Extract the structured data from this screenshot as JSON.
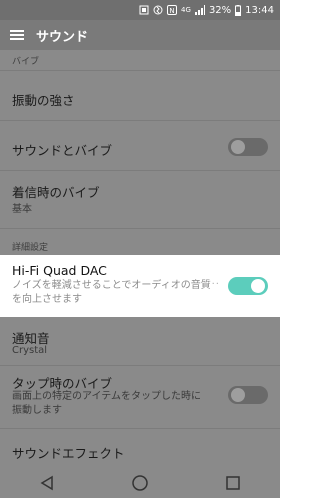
{
  "status": {
    "nfc": "N",
    "battery": "32%",
    "time": "13:44",
    "lte": "4G"
  },
  "appbar": {
    "title": "サウンド"
  },
  "items": {
    "vibrate_partial": "バイブ",
    "vibration_strength": "振動の強さ",
    "sound_and_vibrate": "サウンドとバイブ",
    "ringtone_vibrate": {
      "title": "着信時のバイブ",
      "value": "基本"
    },
    "section_advanced": "詳細設定",
    "hifi": {
      "title": "Hi-Fi Quad DAC",
      "desc": "ノイズを軽減させることでオーディオの音質を向上させます"
    },
    "notification": {
      "title": "通知音",
      "value": "Crystal"
    },
    "tap_vibrate": {
      "title": "タップ時のバイブ",
      "desc": "画面上の特定のアイテムをタップした時に振動します"
    },
    "sound_effect": "サウンドエフェクト"
  },
  "toggles": {
    "sound_and_vibrate": false,
    "hifi": true,
    "tap_vibrate": false
  },
  "colors": {
    "accent": "#5ccdbc",
    "dim": "#8a8a8a"
  },
  "nav": {
    "icons": [
      "back-icon",
      "home-icon",
      "recents-icon"
    ]
  }
}
